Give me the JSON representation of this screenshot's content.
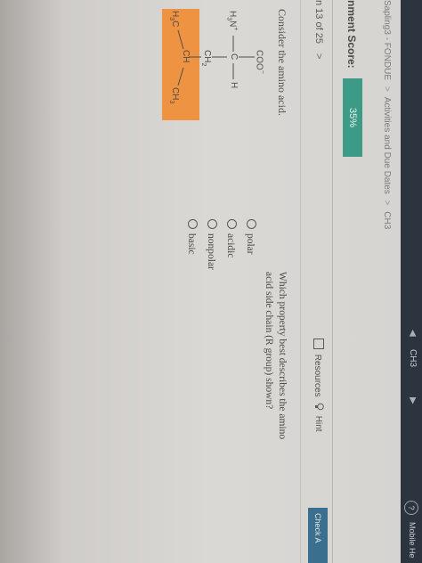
{
  "top_nav": {
    "chapter": "CH3",
    "prev_arrow": "◀",
    "next_arrow": "▶",
    "help": "?",
    "mobile_help": "Mobile He"
  },
  "breadcrumb": {
    "items": [
      "Sapling3 - FONDUE",
      "Activities and Due Dates",
      "CH3"
    ],
    "separator": ">"
  },
  "assignment": {
    "score_label": "nment Score:",
    "score_value": "35%"
  },
  "navigation": {
    "question_counter": "n 13 of 25",
    "next_chevron": ">",
    "resources_label": "Resources",
    "hint_label": "Hint",
    "check_answer_label": "Check A"
  },
  "question": {
    "prompt": "Consider the amino acid.",
    "text": "Which property best describes the amino acid side chain (R group) shown?",
    "options": [
      "polar",
      "acidic",
      "nonpolar",
      "basic"
    ]
  },
  "molecule": {
    "carboxylate": "COO",
    "carboxylate_charge": "−",
    "amine_prefix": "H",
    "amine_sub": "3",
    "amine_atom": "N",
    "amine_charge": "+",
    "alpha_carbon": "C",
    "alpha_h": "H",
    "methylene": "CH",
    "methylene_sub": "2",
    "methine": "CH",
    "methyl_left": "H",
    "methyl_left_sub": "3",
    "methyl_left_c": "C",
    "methyl_right": "CH",
    "methyl_right_sub": "3",
    "highlight_color": "#ef8f3a"
  }
}
